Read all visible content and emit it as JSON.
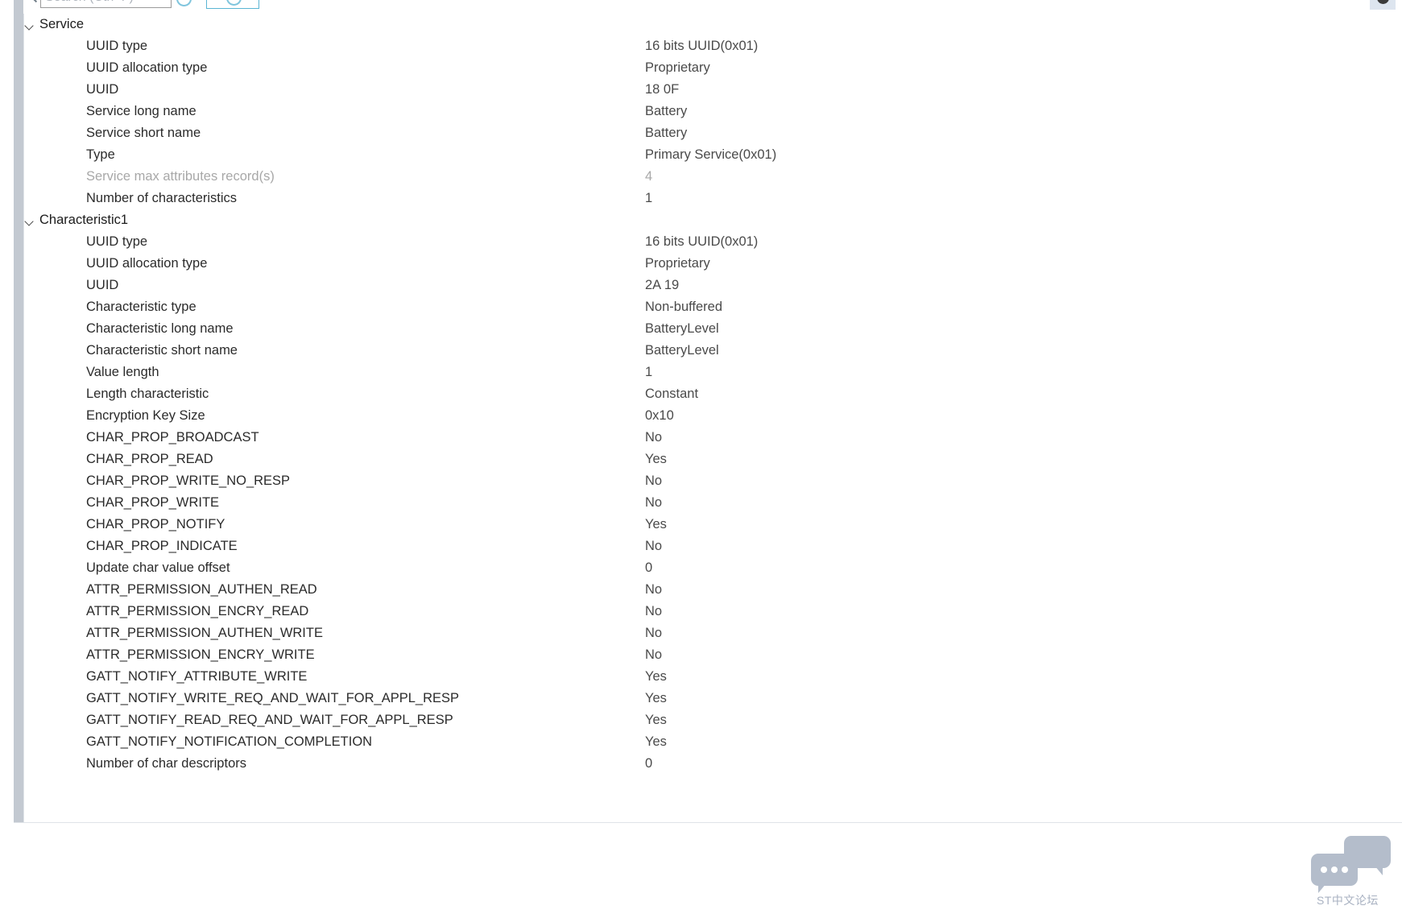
{
  "toolbar": {
    "search_placeholder": "Search (Ctrl+F)",
    "refresh_label": "",
    "refresh_selected_label": ""
  },
  "watermark": {
    "text": "ST中文论坛"
  },
  "groups": [
    {
      "title": "Service",
      "expanded": true,
      "rows": [
        {
          "label": "UUID type",
          "value": "16 bits UUID(0x01)",
          "dim": false
        },
        {
          "label": "UUID allocation type",
          "value": "Proprietary",
          "dim": false
        },
        {
          "label": "UUID",
          "value": "18 0F",
          "dim": false
        },
        {
          "label": "Service long name",
          "value": "Battery",
          "dim": false
        },
        {
          "label": "Service short name",
          "value": "Battery",
          "dim": false
        },
        {
          "label": "Type",
          "value": "Primary Service(0x01)",
          "dim": false
        },
        {
          "label": "Service max attributes record(s)",
          "value": "4",
          "dim": true
        },
        {
          "label": "Number of characteristics",
          "value": "1",
          "dim": false
        }
      ]
    },
    {
      "title": "Characteristic1",
      "expanded": true,
      "rows": [
        {
          "label": "UUID type",
          "value": "16 bits UUID(0x01)",
          "dim": false
        },
        {
          "label": "UUID allocation type",
          "value": "Proprietary",
          "dim": false
        },
        {
          "label": "UUID",
          "value": "2A 19",
          "dim": false
        },
        {
          "label": "Characteristic type",
          "value": "Non-buffered",
          "dim": false
        },
        {
          "label": "Characteristic long name",
          "value": "BatteryLevel",
          "dim": false
        },
        {
          "label": "Characteristic short name",
          "value": "BatteryLevel",
          "dim": false
        },
        {
          "label": "Value length",
          "value": "1",
          "dim": false
        },
        {
          "label": "Length characteristic",
          "value": "Constant",
          "dim": false
        },
        {
          "label": "Encryption Key Size",
          "value": "0x10",
          "dim": false
        },
        {
          "label": "CHAR_PROP_BROADCAST",
          "value": "No",
          "dim": false
        },
        {
          "label": "CHAR_PROP_READ",
          "value": "Yes",
          "dim": false
        },
        {
          "label": "CHAR_PROP_WRITE_NO_RESP",
          "value": "No",
          "dim": false
        },
        {
          "label": "CHAR_PROP_WRITE",
          "value": "No",
          "dim": false
        },
        {
          "label": "CHAR_PROP_NOTIFY",
          "value": "Yes",
          "dim": false
        },
        {
          "label": "CHAR_PROP_INDICATE",
          "value": "No",
          "dim": false
        },
        {
          "label": "Update char value offset",
          "value": "0",
          "dim": false
        },
        {
          "label": "ATTR_PERMISSION_AUTHEN_READ",
          "value": "No",
          "dim": false
        },
        {
          "label": "ATTR_PERMISSION_ENCRY_READ",
          "value": "No",
          "dim": false
        },
        {
          "label": "ATTR_PERMISSION_AUTHEN_WRITE",
          "value": "No",
          "dim": false
        },
        {
          "label": "ATTR_PERMISSION_ENCRY_WRITE",
          "value": "No",
          "dim": false
        },
        {
          "label": "GATT_NOTIFY_ATTRIBUTE_WRITE",
          "value": "Yes",
          "dim": false
        },
        {
          "label": "GATT_NOTIFY_WRITE_REQ_AND_WAIT_FOR_APPL_RESP",
          "value": "Yes",
          "dim": false
        },
        {
          "label": "GATT_NOTIFY_READ_REQ_AND_WAIT_FOR_APPL_RESP",
          "value": "Yes",
          "dim": false
        },
        {
          "label": "GATT_NOTIFY_NOTIFICATION_COMPLETION",
          "value": "Yes",
          "dim": false
        },
        {
          "label": "Number of char descriptors",
          "value": "0",
          "dim": false
        }
      ]
    }
  ]
}
